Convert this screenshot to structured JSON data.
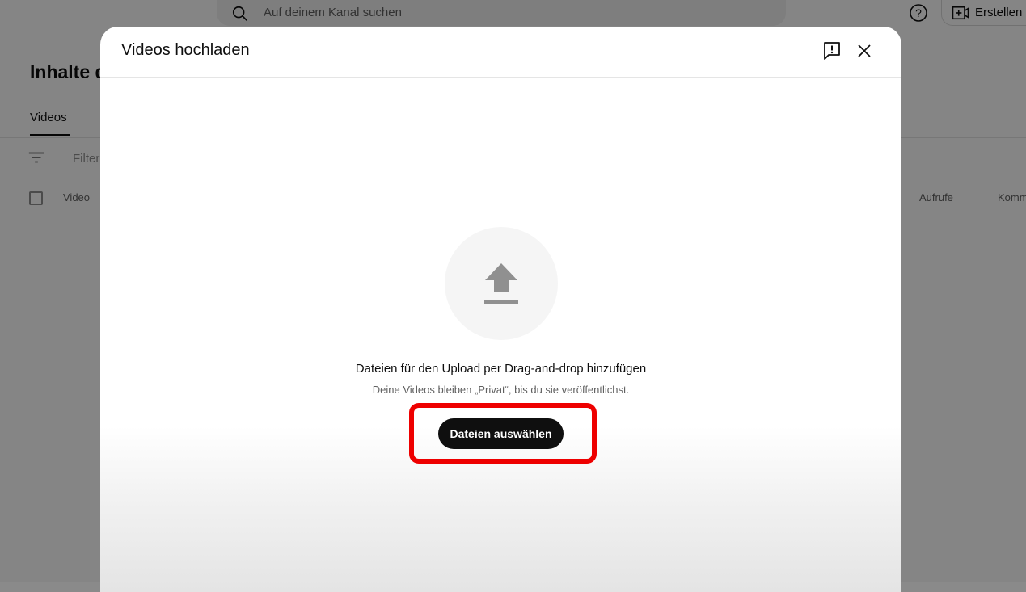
{
  "topbar": {
    "search_placeholder": "Auf deinem Kanal suchen",
    "create_label": "Erstellen",
    "icons": {
      "search": "search-icon",
      "help": "help-icon",
      "create": "create-video-icon"
    }
  },
  "page": {
    "heading": "Inhalte d",
    "tab_videos": "Videos",
    "filter_placeholder": "Filter",
    "columns": {
      "video": "Video",
      "views": "Aufrufe",
      "comments": "Kommentare"
    }
  },
  "dialog": {
    "title": "Videos hochladen",
    "drop_text": "Dateien für den Upload per Drag-and-drop hinzufügen",
    "private_text": "Deine Videos bleiben „Privat“, bis du sie veröffentlichst.",
    "select_button": "Dateien auswählen",
    "icons": {
      "feedback": "feedback-icon",
      "close": "close-icon",
      "upload": "upload-arrow-icon"
    }
  },
  "colors": {
    "highlight": "#ee0000",
    "button_bg": "#0f0f0f",
    "upload_icon": "#909090"
  }
}
